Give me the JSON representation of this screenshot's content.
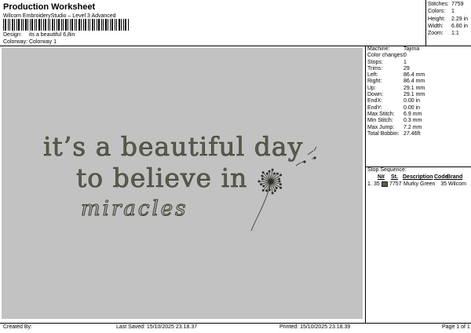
{
  "header": {
    "title": "Production Worksheet",
    "subtitle": "Wilcom EmbroideryStudio – Level 3 Advanced",
    "design_label": "Design:",
    "design_value": "its a beautiful 6,8in",
    "colorway_label": "Colorway:",
    "colorway_value": "Colorway 1"
  },
  "stats": [
    {
      "label": "Stitches:",
      "value": "7759"
    },
    {
      "label": "Colors:",
      "value": "1"
    },
    {
      "label": "Height:",
      "value": "2.29 in"
    },
    {
      "label": "Width:",
      "value": "6.80 in"
    },
    {
      "label": "Zoom:",
      "value": "1:1"
    }
  ],
  "machine": [
    {
      "label": "Machine:",
      "value": "Tajima"
    },
    {
      "label": "Color changes:",
      "value": "0"
    },
    {
      "label": "Stops:",
      "value": "1"
    },
    {
      "label": "Trims:",
      "value": "29"
    },
    {
      "label": "Left:",
      "value": "86.4 mm"
    },
    {
      "label": "Right:",
      "value": "86.4 mm"
    },
    {
      "label": "Up:",
      "value": "29.1 mm"
    },
    {
      "label": "Down:",
      "value": "29.1 mm"
    },
    {
      "label": "EndX:",
      "value": "0.00 in"
    },
    {
      "label": "EndY:",
      "value": "0.00 in"
    },
    {
      "label": "Max Stitch:",
      "value": "6.9 mm"
    },
    {
      "label": "Min Stitch:",
      "value": "0.3 mm"
    },
    {
      "label": "Max Jump:",
      "value": "7.2 mm"
    },
    {
      "label": "Total Bobbin:",
      "value": "27.46ft"
    }
  ],
  "stop_sequence": {
    "title": "Stop Sequence:",
    "columns": [
      "N#",
      "St.",
      "Description",
      "Code",
      "Brand"
    ],
    "rows": [
      {
        "index": "1.",
        "n": "35",
        "st": "7757",
        "description": "Murky Green",
        "code": "35",
        "brand": "Wilcom",
        "color": "#5a5c4a"
      }
    ]
  },
  "design": {
    "line1": "it’s a beautiful day",
    "line2": "to believe in",
    "line3": "miracles",
    "thread_color": "#5a5c4a",
    "canvas_color": "#c2c2c2"
  },
  "footer": {
    "created_by": "Created By:",
    "last_saved": "Last Saved: 15/10/2025 23.18.37",
    "printed": "Printed: 15/10/2025 23.18.39",
    "page": "Page 1 of 1"
  }
}
